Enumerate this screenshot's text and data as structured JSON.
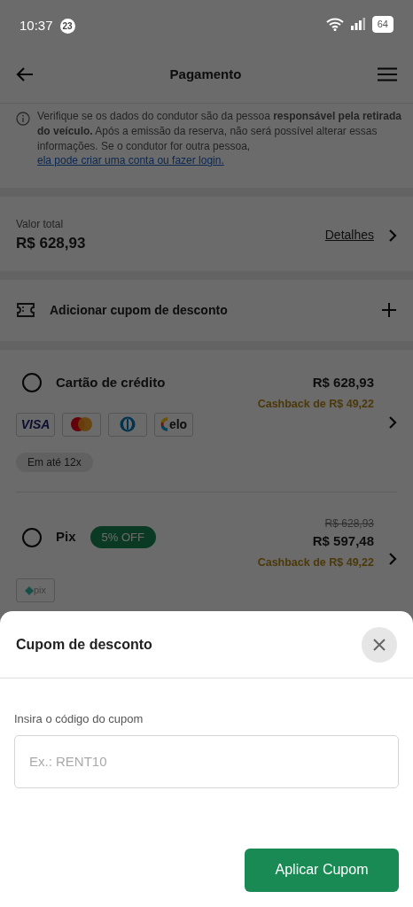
{
  "status_bar": {
    "time": "10:37",
    "notification_count": "23",
    "battery": "64"
  },
  "header": {
    "title": "Pagamento"
  },
  "notice": {
    "text": "Verifique se os dados do condutor são da pessoa **responsável pela retirada do veículo.** Após a emissão da reserva, não será possível alterar essas informações. Se o condutor for outra pessoa, ",
    "link": "ela pode criar uma conta ou fazer login."
  },
  "total": {
    "label": "Valor total",
    "value": "R$ 628,93",
    "details_link": "Detalhes"
  },
  "coupon_row": {
    "label": "Adicionar cupom de desconto"
  },
  "payment_methods": [
    {
      "name": "Cartão de crédito",
      "selected": false,
      "price": "R$ 628,93",
      "cashback": "Cashback de R$ 49,22",
      "brands": [
        {
          "kind": "visa",
          "label": "VISA"
        },
        {
          "kind": "mastercard"
        },
        {
          "kind": "diners"
        },
        {
          "kind": "elo",
          "label": "elo"
        }
      ],
      "installments": "Em até 12x"
    },
    {
      "name": "Pix",
      "selected": false,
      "discount_badge": "5% OFF",
      "old_price": "R$ 628,93",
      "price": "R$ 597,48",
      "cashback": "Cashback de R$ 49,22",
      "brands": [
        {
          "kind": "pix",
          "label": "pix"
        }
      ]
    }
  ],
  "coupon_sheet": {
    "title": "Cupom de desconto",
    "field_label": "Insira o código do cupom",
    "placeholder": "Ex.: RENT10",
    "apply_button": "Aplicar Cupom"
  }
}
